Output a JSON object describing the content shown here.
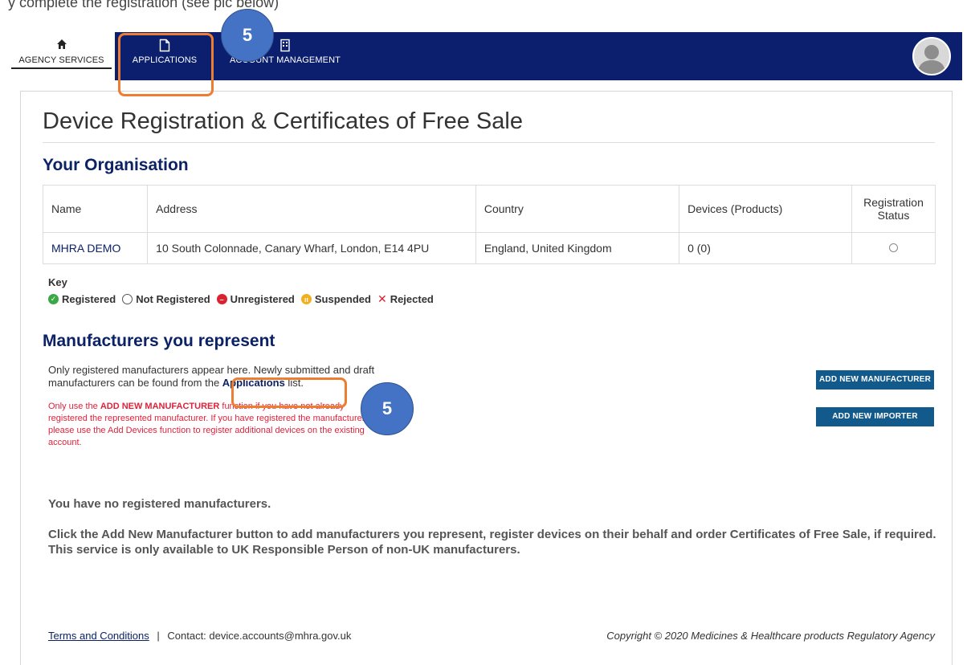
{
  "doc_text_fragment": "y complete the registration (see pic below)",
  "nav": {
    "agency": "AGENCY SERVICES",
    "applications": "APPLICATIONS",
    "account": "ACCOUNT MANAGEMENT"
  },
  "page_title": "Device Registration & Certificates of Free Sale",
  "org": {
    "section_title": "Your Organisation",
    "headers": [
      "Name",
      "Address",
      "Country",
      "Devices (Products)",
      "Registration Status"
    ],
    "row": {
      "name": "MHRA DEMO",
      "address": "10 South Colonnade, Canary Wharf, London, E14 4PU",
      "country": "England, United Kingdom",
      "devices": "0 (0)"
    }
  },
  "key": {
    "title": "Key",
    "items": [
      "Registered",
      "Not Registered",
      "Unregistered",
      "Suspended",
      "Rejected"
    ],
    "colors": {
      "registered": "#3aa845",
      "unregistered": "#d9232e",
      "suspended": "#f2b01e",
      "rejected": "#d9232e"
    }
  },
  "manufacturers": {
    "section_title": "Manufacturers you represent",
    "info_line1": "Only registered manufacturers appear here. Newly submitted and draft",
    "info_line2_pre": "manufacturers can be found from the ",
    "info_link": "Applications",
    "info_line2_post": " list.",
    "warn_pre": "Only use the ",
    "warn_bold": "ADD NEW MANUFACTURER",
    "warn_post": " function if you have not already registered the represented manufacturer. If you have registered the manufacturer, please use the Add Devices function to register additional devices on the existing account.",
    "add_manufacturer": "ADD NEW MANUFACTURER",
    "add_importer": "ADD NEW IMPORTER",
    "no_registered": "You have no registered manufacturers.",
    "click_text": "Click the Add New Manufacturer button to add manufacturers you represent, register devices on their behalf and order Certificates of Free Sale, if required. This service is only available to UK Responsible Person of non-UK manufacturers."
  },
  "footer": {
    "terms": "Terms and Conditions",
    "separator": "|",
    "contact": "Contact: device.accounts@mhra.gov.uk",
    "copyright": "Copyright © 2020 Medicines & Healthcare products Regulatory Agency"
  },
  "annotations": {
    "badge_top": "5",
    "badge_mid": "5",
    "highlight_color": "#ed7d31",
    "badge_color": "#4472c4"
  }
}
